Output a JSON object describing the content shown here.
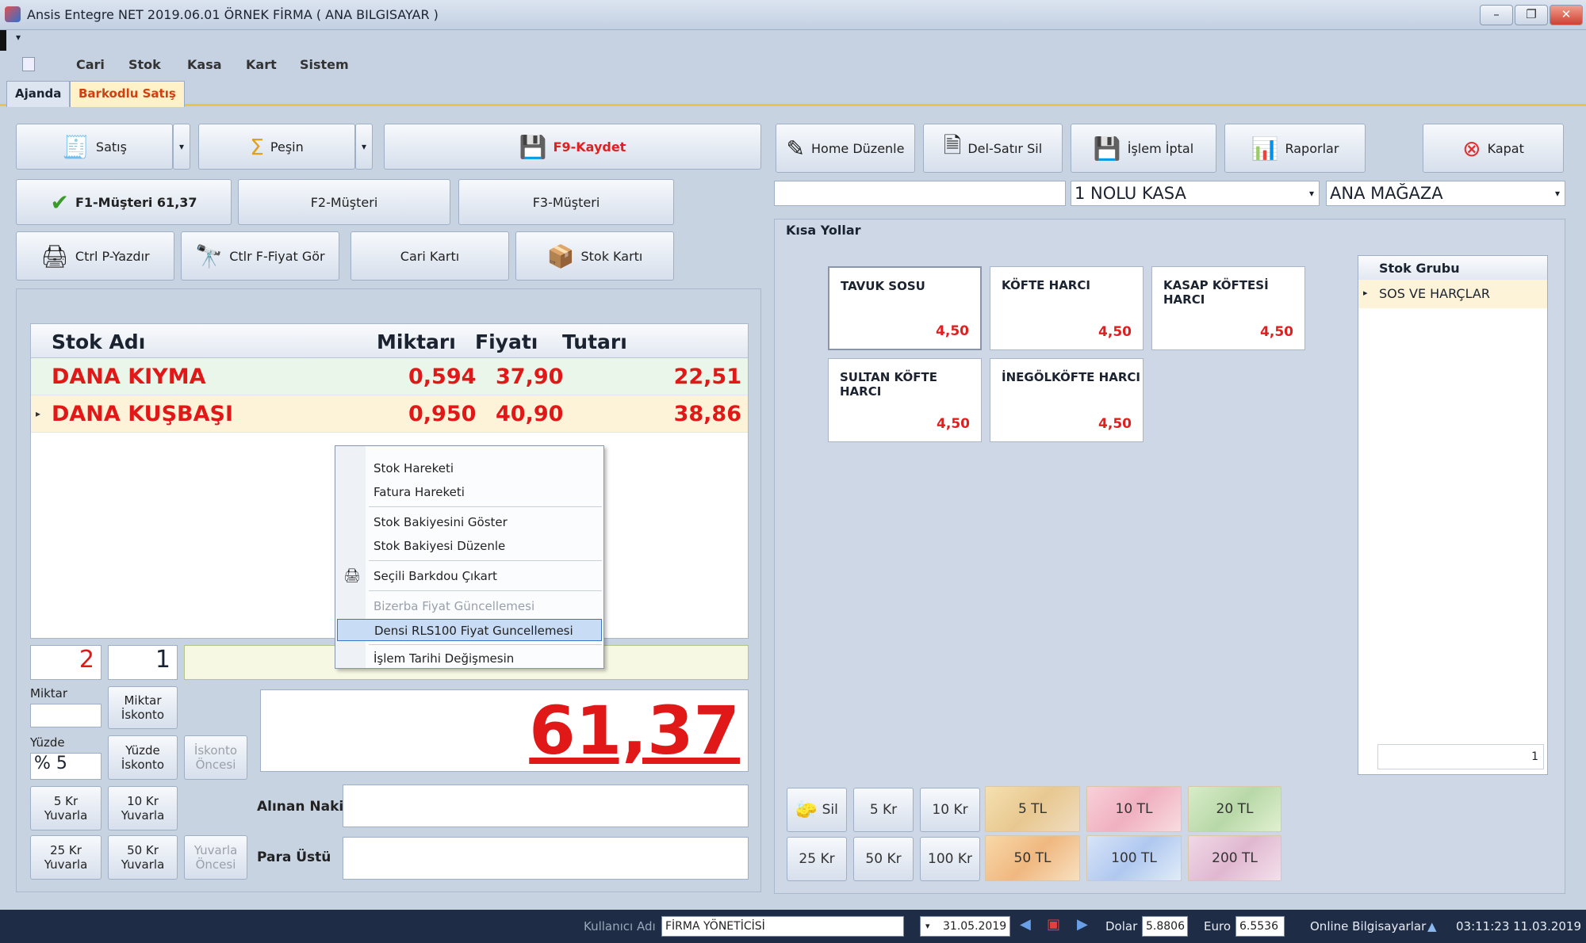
{
  "window": {
    "title": "Ansis Entegre NET 2019.06.01 ÖRNEK FİRMA ( ANA BILGISAYAR )"
  },
  "menu": [
    "Cari",
    "Stok",
    "Kasa",
    "Kart",
    "Sistem"
  ],
  "tabs": [
    "Ajanda",
    "Barkodlu Satış"
  ],
  "toolbar_left": {
    "satis": "Satış",
    "pesin": "Peşin",
    "kaydet": "F9-Kaydet",
    "musteri1": "F1-Müşteri 61,37",
    "musteri2": "F2-Müşteri",
    "musteri3": "F3-Müşteri",
    "yazdir": "Ctrl P-Yazdır",
    "fiyat_gor": "Ctlr F-Fiyat Gör",
    "cari_karti": "Cari Kartı",
    "stok_karti": "Stok Kartı"
  },
  "toolbar_right": {
    "home": "Home  Düzenle",
    "del": "Del-Satır Sil",
    "iptal": "İşlem İptal",
    "raporlar": "Raporlar",
    "kapat": "Kapat",
    "kasa": "1 NOLU KASA",
    "magaza": "ANA MAĞAZA"
  },
  "grid": {
    "headers": [
      "Stok Adı",
      "Miktarı",
      "Fiyatı",
      "Tutarı"
    ],
    "rows": [
      {
        "name": "DANA KIYMA",
        "qty": "0,594",
        "price": "37,90",
        "total": "22,51"
      },
      {
        "name": "DANA KUŞBAŞI",
        "qty": "0,950",
        "price": "40,90",
        "total": "38,86"
      }
    ]
  },
  "context_menu": [
    "Stok Hareketi",
    "Fatura Hareketi",
    "Stok Bakiyesini Göster",
    "Stok Bakiyesi Düzenle",
    "Seçili Barkdou Çıkart",
    "Bizerba Fiyat Güncellemesi",
    "Densi RLS100 Fiyat Guncellemesi",
    "İşlem Tarihi Değişmesin"
  ],
  "entry": {
    "count": "2",
    "qty": "1"
  },
  "discount": {
    "miktar_label": "Miktar",
    "miktar_iskonto": "Miktar İskonto",
    "yuzde_label": "Yüzde",
    "yuzde_value": "% 5",
    "yuzde_iskonto": "Yüzde İskonto",
    "iskonto_oncesi": "İskonto Öncesi",
    "yuvarla5": "5 Kr Yuvarla",
    "yuvarla10": "10 Kr Yuvarla",
    "yuvarla25": "25 Kr Yuvarla",
    "yuvarla50": "50 Kr Yuvarla",
    "yuvarla_oncesi": "Yuvarla Öncesi"
  },
  "total": "61,37",
  "payment": {
    "alinan": "Alınan Nakit",
    "para_ustu": "Para Üstü"
  },
  "shortcuts": {
    "title": "Kısa Yollar",
    "items": [
      {
        "name": "TAVUK SOSU",
        "price": "4,50"
      },
      {
        "name": "KÖFTE HARCI",
        "price": "4,50"
      },
      {
        "name": "KASAP KÖFTESİ HARCI",
        "price": "4,50"
      },
      {
        "name": "SULTAN KÖFTE HARCI",
        "price": "4,50"
      },
      {
        "name": "İNEGÖLKÖFTE HARCI",
        "price": "4,50"
      }
    ],
    "group_header": "Stok Grubu",
    "group_item": "SOS VE HARÇLAR",
    "group_page": "1"
  },
  "money": {
    "sil": "Sil",
    "k5": "5 Kr",
    "k10": "10 Kr",
    "k25": "25 Kr",
    "k50": "50 Kr",
    "k100": "100 Kr",
    "notes": [
      "5 TL",
      "10 TL",
      "20 TL",
      "50 TL",
      "100 TL",
      "200 TL"
    ]
  },
  "status": {
    "user_label": "Kullanıcı Adı",
    "user": "FİRMA YÖNETİCİSİ",
    "date": "31.05.2019",
    "dolar_label": "Dolar",
    "dolar": "5.8806",
    "euro_label": "Euro",
    "euro": "6.5536",
    "online": "Online Bilgisayarlar",
    "clock": "03:11:23 11.03.2019"
  },
  "colors": {
    "accent": "#f0c04a",
    "total_red": "#e01818"
  }
}
